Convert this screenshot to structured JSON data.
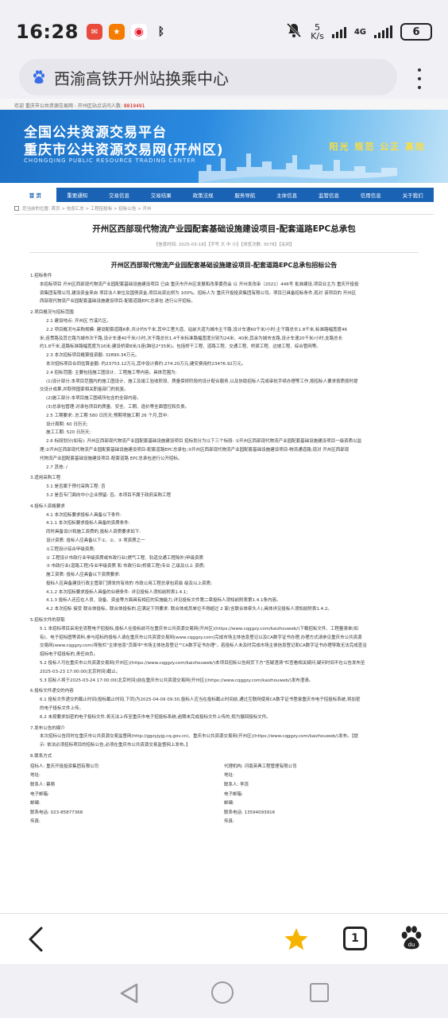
{
  "status_bar": {
    "time": "16:28",
    "speed_value": "5",
    "speed_unit": "K/s",
    "network": "4G",
    "battery": "6"
  },
  "browser": {
    "page_title": "西渝高铁开州站换乘中心",
    "tab_count": "1"
  },
  "site": {
    "topline": "欢迎 重庆市公共资源交易网 - 开州区站点访问人数:",
    "visits": "8819491",
    "title_line1": "全国公共资源交易平台",
    "title_line2": "重庆市公共资源交易网(开州区)",
    "title_en": "CHONGQING PUBLIC RESOURCE TRADING CENTER",
    "slogan": "阳光 规范 公正 高效",
    "nav": [
      "首 页",
      "重要通知",
      "交易信息",
      "交易结果",
      "政策法规",
      "服务导航",
      "主体信息",
      "监管信息",
      "信用信息",
      "关于我们"
    ],
    "breadcrumb": "您当前的位置: 首页 > 信息汇总 > 工程招投标 > 招标公告 > 开州"
  },
  "article": {
    "title": "开州区西部现代物流产业园配套基础设施建设项目-配套道路EPC总承包",
    "meta": "【信息时间: 2025-03-18】【字号 大 中 小】【浏览次数: 3078】【关闭】",
    "subtitle": "开州区西部现代物流产业园配套基础设施建设项目-配套道路EPC总承包招标公告",
    "paragraphs": [
      {
        "cls": "sec",
        "text": "1.招标条件"
      },
      {
        "cls": "i1",
        "text": "本招标项目 开州区西部现代物流产业园配套基础设施建设项目 已由 重庆市开州区发展和改革委员会 以 开州发改审〔2021〕446号 批准建设,项目业主为 重庆开投投"
      },
      {
        "cls": "i1",
        "text": "资集团有限公司,建设资金来自 项目法人单位及国债资金,项目出资比例为 100%。招标人为 重庆开投投资集团有限公司。项目已具备招标条件,现对 该项目的 开州区"
      },
      {
        "cls": "i1",
        "text": "西部现代物流产业园配套基础设施建设项目-配套道路EPC总承包 进行公开招标。"
      },
      {
        "cls": "sec",
        "text": "2.项目概况与招标范围"
      },
      {
        "cls": "i2",
        "text": "2.1 建设地点: 开州区 竹溪片区。"
      },
      {
        "cls": "i2",
        "text": "2.2 项目概况与采购规模: 建设配套道路6条,共计约5千米,其中江里大道、站前大道为城市主干路,设计车速60千米/小时;主干路总长1.8千米,标准路幅宽度46"
      },
      {
        "cls": "i1",
        "text": "米;连贯路及其它路为城市次干路,设计车速40千米/小时,次干路总长1.4千米标准路幅宽度分别为24米、40米;其余为城市支路,设计车速20千米/小时,支路总长"
      },
      {
        "cls": "i1",
        "text": "约1.8千米,道路标准路幅宽度为16米;建设桥梁8米/1座(跨径2*35米)。包括桥干工程、道路工程、交通工程、桥梁工程、边坡工程、综合管网等。"
      },
      {
        "cls": "i2",
        "text": "2.3 本次招标项目概算投资额: 32890.34万元。"
      },
      {
        "cls": "i2",
        "text": "本次招标项目合同估算金额: 约23753.12万元,其中设计费约:274.20万元;建安费用约23476.92万元。"
      },
      {
        "cls": "i2",
        "text": "2.4 招标范围: 主要包括施工图设计、工程施工等内容。具体范围为:"
      },
      {
        "cls": "i2",
        "text": "(1)设计部分:本项目范围内的施工图设计、施工及竣工验收阶段、质量保修阶段的设计配合服务,以及协助招标人完成审批手续办理等工作,按招标人要求按质按时提"
      },
      {
        "cls": "i1",
        "text": "交设计成果,并取得国家相关职能部门的批复。"
      },
      {
        "cls": "i2",
        "text": "(2)施工部分:本项目施工图纸所包含的全部内容。"
      },
      {
        "cls": "i2",
        "text": "(3)总承包管理:对承包项目的质量、安全、工期、造价等全面管控和负责。"
      },
      {
        "cls": "i2",
        "text": "2.5 工期要求: 总工期 580 日历天;预期项施工期 26 个月,其中:"
      },
      {
        "cls": "i2",
        "text": "设计周期: 60 日历天;"
      },
      {
        "cls": "i2",
        "text": "施工工期: 520 日历天;"
      },
      {
        "cls": "i2",
        "text": "2.6 标段划分(如有): 开州区西部现代物流产业园配套基础设施建设项目 招标划分为以下三个标段: ①开州区西部现代物流产业园配套基础设施建设项目一级资质以监"
      },
      {
        "cls": "i1",
        "text": "理;②开州区西部现代物流产业园配套基础设施建设项目-配套道路EPC总承包;③开州区西部现代物流产业园配套基础设施建设项目-物流通道路;现对 开州区西部现"
      },
      {
        "cls": "i1",
        "text": "代物流产业园配套基础设施建设项目-配套道路 EPC总承包进行公开招标。"
      },
      {
        "cls": "i2",
        "text": "2.7 其他: /"
      },
      {
        "cls": "sec",
        "text": "3.适用采购工程"
      },
      {
        "cls": "i2",
        "text": "3.1 是否属于预付采购工程: 否"
      },
      {
        "cls": "i2",
        "text": "3.2 是否专门面向中小企业预留: 否。本项目不属于政府采购工程"
      },
      {
        "cls": "sec",
        "text": "4.投标人资格要求"
      },
      {
        "cls": "i2",
        "text": "4.1 本次招标要求投标人具备以下条件:"
      },
      {
        "cls": "i2",
        "text": "4.1.1 本次招标要求投标人具备的资质条件:"
      },
      {
        "cls": "i2",
        "text": "同时具备设计和施工资质的,投标人资质要求如下:"
      },
      {
        "cls": "i2",
        "text": "设计资质: 投标人应具备以下①、②、③ 项资质之一"
      },
      {
        "cls": "i2",
        "text": "①工程设计综合甲级资质;"
      },
      {
        "cls": "i2",
        "text": "② 工程设计市政行业甲级资质或市政行业(燃气工程、轨道交通工程除外)甲级资质"
      },
      {
        "cls": "i2",
        "text": "③ 市政行业(道路工程)专业甲级资质 和 市政行业(桥梁工程)专业 乙级及以上 资质;"
      },
      {
        "cls": "i2",
        "text": "施工资质: 投标人应具备以下资质要求:"
      },
      {
        "cls": "i2",
        "text": "投标人应具备建设行政主管部门颁发的有效的 市政公用工程总承包贰级 级及以上资质;"
      },
      {
        "cls": "i2",
        "text": "4.1.2 本次招标要求投标人具备的业绩条件: 详见投标人须知前附表1.4.1;"
      },
      {
        "cls": "i2",
        "text": "4.1.3 投标人还应在人员、设备、资金等方面具有相应的实施能力,详见投标文件第二章投标人须知前附表第1.4.1条内容。"
      },
      {
        "cls": "i2",
        "text": "4.2 本次招标 接受 联合体投标。联合体投标的,应满足下列要求: 联合体成员单位不得超过 2 家(含联合体牵头人),具体详见投标人须知前附表1.4.2。"
      },
      {
        "cls": "sec",
        "text": "5.招标文件的获取"
      },
      {
        "cls": "i1",
        "text": "5.1 本招标项目采用全流程电子招投标,投标人在投标前可在重庆市公共资源交易网(开州区)(https://www.cqggzy.com/kaizhouweb/)下载招标文件、工程量清单(如"
      },
      {
        "cls": "i1",
        "text": "有)、电子招标图等资料,参与招标的投标人请在重庆市公共资源交易网(www.cqggzy.com)完成市场主体信息登记以及CA数字证书办理,办理方式请参见重庆市公共资源"
      },
      {
        "cls": "i1",
        "text": "交易网(www.cqggzy.com)导航栏\"主体信息\"页面中\"市场主体信息登记\"\"CA数字证书办理\"。若投标人未及时完成市场主体信息登记和CA数字证书办理导致无法完成查洽"
      },
      {
        "cls": "i1",
        "text": "招标电子招投标的,责任自负。"
      },
      {
        "cls": "i1",
        "text": "5.2 投标人可在重庆市公共资源交易网(开州区)(https://www.cqggzy.com/kaizhouweb/)本项目招标公告网页下方\"答疑澄清\"栏查看相关疑问,疑问时间不在公告发布至"
      },
      {
        "cls": "i1",
        "text": "2025-03-23 17:00:00(北京时间)截止。"
      },
      {
        "cls": "i1",
        "text": "5.3 招标人将于2025-03-24 17:00:00(北京时间)前在重庆市公共资源交易网(开州区)(https://www.cqggzy.com/kaizhouweb/)发布澄清。"
      },
      {
        "cls": "sec",
        "text": "6.投标文件递交的内容"
      },
      {
        "cls": "i1",
        "text": "6.1 投标文件递交的截止时间(投标截止时间,下同)为2025-04-09 09:30,投标人应当在投标截止时间前,通过互联网使用CA数字证书登录重庆市电子招投标系统,将加密"
      },
      {
        "cls": "i1",
        "text": "的电子投标文件上传。"
      },
      {
        "cls": "i1",
        "text": "6.2 未按要求加密的电子投标文件,将无法上传至重庆市电子招投标系统,逾期未完成投标文件上传的,视为撤回投标文件。"
      },
      {
        "cls": "sec",
        "text": "7.发布公告的媒介"
      },
      {
        "cls": "i1",
        "text": "本次招标公告同时在重庆市公共资源交易监督网(http://ggzyjyjg.cq.gov.cn)、重庆市公共资源交易网(开州区)(https://www.cqggzy.com/kaizhouweb/)发布。【提"
      },
      {
        "cls": "i1",
        "text": "示: 依法必须招标项目的招标公告,必须在重庆市公共资源交易监督网上发布。】"
      },
      {
        "cls": "sec",
        "text": "8.联系方式"
      }
    ],
    "contact_left": [
      "招标人: 重庆开投投资集团有限公司",
      "地址:",
      "联系人: 蔡萌",
      "电子邮箱:",
      "邮编:",
      "联系电话: 023-85877368",
      "传真:"
    ],
    "contact_right": [
      "代理机构: 河南英典工程管理有限公司",
      "地址:",
      "联系人: 李蕊",
      "电子邮箱:",
      "邮编:",
      "联系电话: 13594093916",
      "传真:"
    ]
  },
  "colors": {
    "brand_blue": "#1a62b4",
    "star_yellow": "#f5b400",
    "slogan_yellow": "#ffde3a"
  },
  "icons": [
    "back-arrow-icon",
    "star-icon",
    "tabs-icon",
    "paw-icon",
    "more-icon"
  ]
}
